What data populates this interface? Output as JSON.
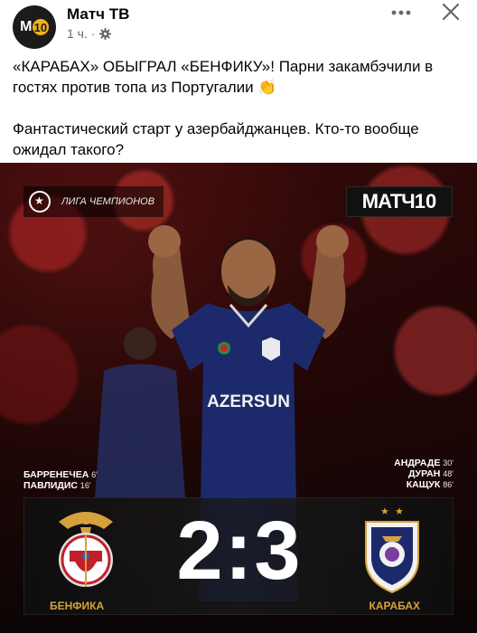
{
  "post": {
    "page_name": "Матч ТВ",
    "time": "1 ч.",
    "separator": "·",
    "avatar_text": "M",
    "avatar_badge": "10",
    "text_line1": "«КАРАБАХ» ОБЫГРАЛ «БЕНФИКУ»! Парни закамбэчили в гостях против топа из Португалии 👏",
    "text_line2": "Фантастический старт у азербайджанцев. Кто-то вообще ожидал такого?"
  },
  "image": {
    "competition": "Лига Чемпионов",
    "logo_word": "МАТЧ",
    "logo_num": "10",
    "jersey_sponsor": "AZERSUN",
    "home_scorers": [
      {
        "name": "БАРРЕНЕЧЕА",
        "minute": "6'"
      },
      {
        "name": "ПАВЛИДИС",
        "minute": "16'"
      }
    ],
    "away_scorers": [
      {
        "name": "АНДРАДЕ",
        "minute": "30'"
      },
      {
        "name": "ДУРАН",
        "minute": "48'"
      },
      {
        "name": "КАЩУК",
        "minute": "86'"
      }
    ],
    "score": "2:3",
    "home_team": "БЕНФИКА",
    "away_team": "КАРАБАХ"
  },
  "colors": {
    "accent_gold": "#d5a23b",
    "text_secondary": "#65676b",
    "qarabag_blue": "#1c2a6b"
  },
  "icons": {
    "more": "more-horizontal-icon",
    "close": "close-icon",
    "audience": "gear-icon"
  }
}
